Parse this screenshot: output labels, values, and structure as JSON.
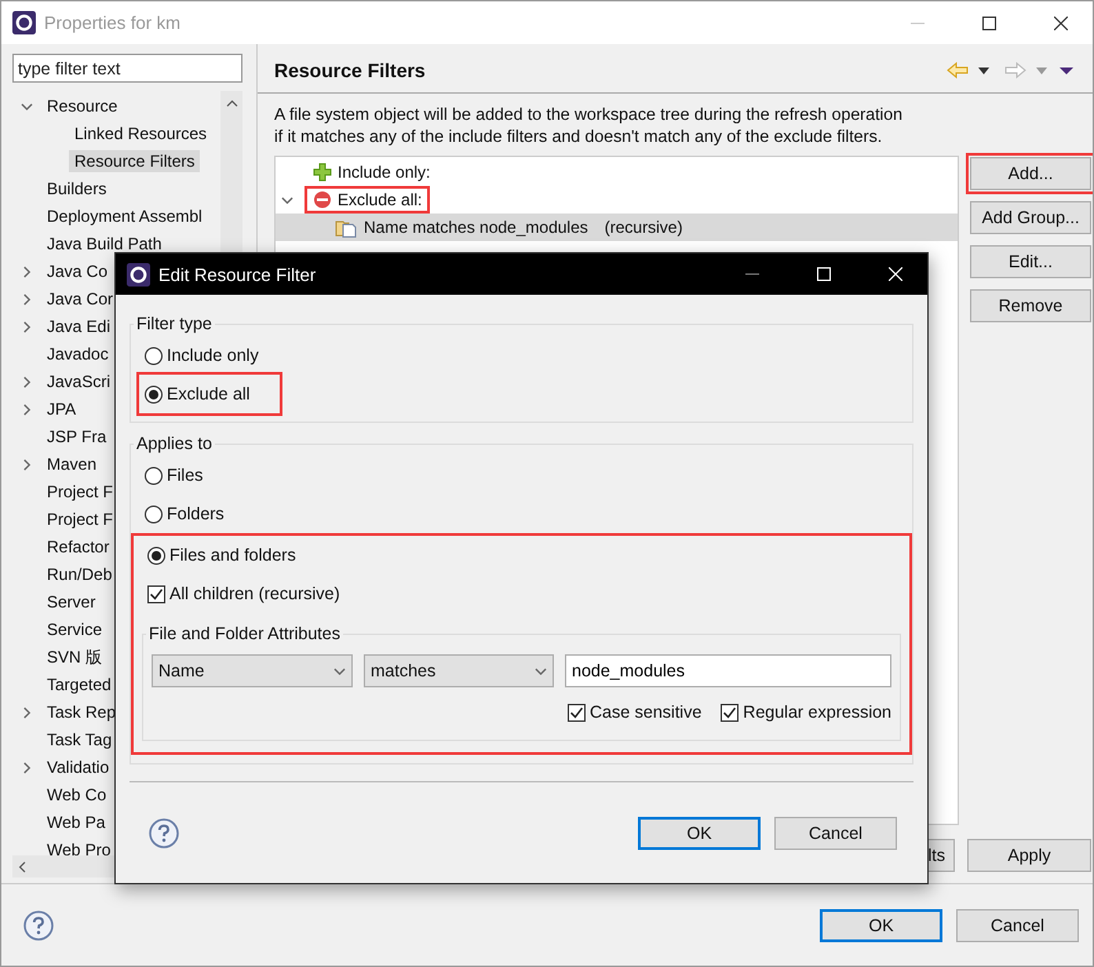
{
  "window": {
    "title": "Properties for km"
  },
  "sidebar": {
    "filter_placeholder": "type filter text",
    "items": [
      {
        "label": "Resource",
        "expanded": true,
        "selected": false,
        "children": [
          {
            "label": "Linked Resources",
            "selected": false
          },
          {
            "label": "Resource Filters",
            "selected": true
          }
        ]
      },
      {
        "label": "Builders",
        "selected": false
      },
      {
        "label": "Deployment Assembl",
        "selected": false
      },
      {
        "label": "Java Build Path",
        "selected": false
      },
      {
        "label": "Java Co",
        "expanded": false,
        "selected": false
      },
      {
        "label": "Java Cor",
        "expanded": false,
        "selected": false
      },
      {
        "label": "Java Edi",
        "expanded": false,
        "selected": false
      },
      {
        "label": "Javadoc",
        "selected": false
      },
      {
        "label": "JavaScri",
        "expanded": false,
        "selected": false
      },
      {
        "label": "JPA",
        "expanded": false,
        "selected": false
      },
      {
        "label": "JSP Fra",
        "selected": false
      },
      {
        "label": "Maven",
        "expanded": false,
        "selected": false
      },
      {
        "label": "Project F",
        "selected": false
      },
      {
        "label": "Project F",
        "selected": false
      },
      {
        "label": "Refactor",
        "selected": false
      },
      {
        "label": "Run/Deb",
        "selected": false
      },
      {
        "label": "Server",
        "selected": false
      },
      {
        "label": "Service",
        "selected": false
      },
      {
        "label": "SVN 版",
        "selected": false
      },
      {
        "label": "Targeted",
        "selected": false
      },
      {
        "label": "Task Rep",
        "expanded": false,
        "selected": false
      },
      {
        "label": "Task Tag",
        "selected": false
      },
      {
        "label": "Validatio",
        "expanded": false,
        "selected": false
      },
      {
        "label": "Web Co",
        "selected": false
      },
      {
        "label": "Web Pa",
        "selected": false
      },
      {
        "label": "Web Pro",
        "selected": false
      }
    ]
  },
  "page": {
    "title": "Resource Filters",
    "description": [
      "A file system object will be added to the workspace tree during the refresh operation",
      "if it matches any of the include filters and doesn't match any of the exclude filters."
    ],
    "filters": [
      {
        "label": "Include only:",
        "kind": "include",
        "highlighted": false
      },
      {
        "label": "Exclude all:",
        "kind": "exclude",
        "expanded": true,
        "highlighted": true,
        "children": [
          {
            "label": "Name matches node_modules",
            "note": "(recursive)",
            "selected": true
          }
        ]
      }
    ],
    "buttons": [
      {
        "label": "Add...",
        "highlighted": true
      },
      {
        "label": "Add Group...",
        "highlighted": false
      },
      {
        "label": "Edit...",
        "highlighted": false
      },
      {
        "label": "Remove",
        "highlighted": false
      }
    ],
    "bottom_buttons": [
      "lts",
      "Apply"
    ]
  },
  "footer": {
    "buttons": [
      {
        "label": "OK",
        "default": true
      },
      {
        "label": "Cancel",
        "default": false
      }
    ]
  },
  "dialog": {
    "title": "Edit Resource Filter",
    "filter_type": {
      "label": "Filter type",
      "options": [
        {
          "label": "Include only",
          "selected": false,
          "highlighted": false
        },
        {
          "label": "Exclude all",
          "selected": true,
          "highlighted": true
        }
      ]
    },
    "applies_to": {
      "label": "Applies to",
      "options": [
        {
          "label": "Files",
          "selected": false,
          "highlighted": false
        },
        {
          "label": "Folders",
          "selected": false,
          "highlighted": false
        },
        {
          "label": "Files and folders",
          "selected": true,
          "highlighted": true
        }
      ],
      "recursive": {
        "label": "All children (recursive)",
        "checked": true
      }
    },
    "attributes": {
      "label": "File and Folder Attributes",
      "attribute": "Name",
      "operator": "matches",
      "value": "node_modules",
      "options": [
        {
          "label": "Case sensitive",
          "checked": true
        },
        {
          "label": "Regular expression",
          "checked": true
        }
      ]
    },
    "buttons": [
      {
        "label": "OK",
        "default": true
      },
      {
        "label": "Cancel",
        "default": false
      }
    ]
  }
}
